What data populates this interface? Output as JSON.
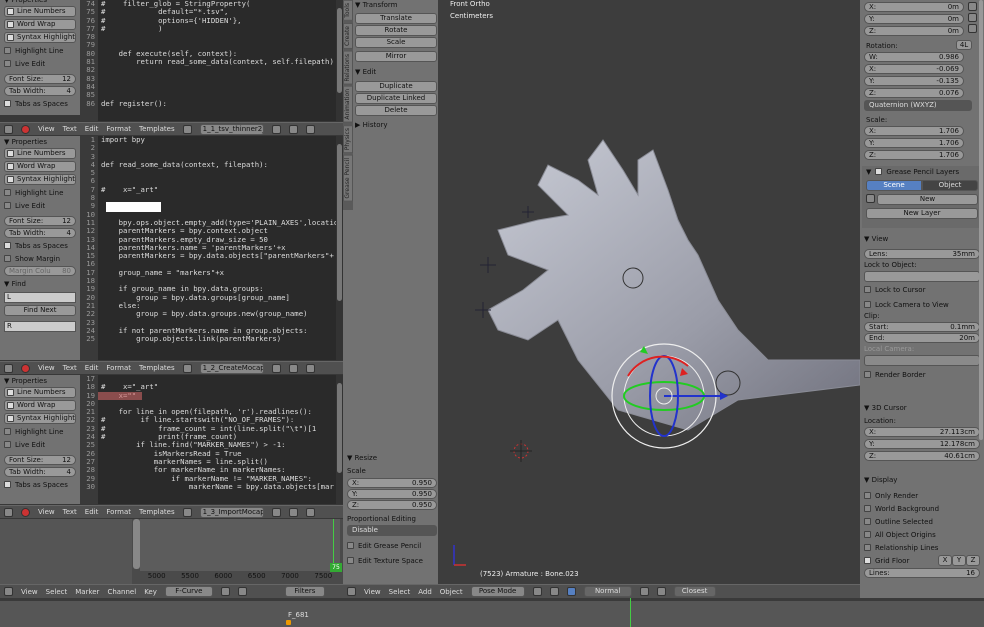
{
  "props_panel": {
    "title": "Properties",
    "line_numbers": "Line Numbers",
    "word_wrap": "Word Wrap",
    "syntax": "Syntax Highlight",
    "highlight_line": "Highlight Line",
    "live_edit": "Live Edit",
    "font_size_label": "Font Size:",
    "font_size": "12",
    "tab_width_label": "Tab Width:",
    "tab_width": "4",
    "tabs_spaces": "Tabs as Spaces",
    "show_margin": "Show Margin",
    "margin_col_label": "Margin Colu",
    "margin_col": "80",
    "find": "Find",
    "find_field": "L",
    "find_next": "Find Next",
    "replace_field": "R"
  },
  "editor_menu": {
    "view": "View",
    "text": "Text",
    "edit": "Edit",
    "format": "Format",
    "templates": "Templates"
  },
  "editors": [
    {
      "file": "1_1_tsv_thinner2_b...",
      "start": 74,
      "lines": [
        "#    filter_glob = StringProperty(",
        "#            default=\"*.tsv\",",
        "#            options={'HIDDEN'},",
        "#            )",
        "",
        "",
        "    def execute(self, context):",
        "        return read_some_data(context, self.filepath)",
        "",
        "",
        "",
        "",
        "def register():"
      ]
    },
    {
      "file": "1_2_CreateMocapM...",
      "start": 1,
      "lines": [
        "import bpy",
        "",
        "",
        "def read_some_data(context, filepath):",
        "",
        "",
        "#    x=\"_art\"",
        "",
        "",
        "",
        "    bpy.ops.object.empty_add(type='PLAIN_AXES',locatio",
        "    parentMarkers = bpy.context.object",
        "    parentMarkers.empty_draw_size = 50",
        "    parentMarkers.name = 'parentMarkers'+x",
        "    parentMarkers = bpy.data.objects[\"parentMarkers\"+",
        "",
        "    group_name = \"markers\"+x",
        "",
        "    if group_name in bpy.data.groups:",
        "        group = bpy.data.groups[group_name]",
        "    else:",
        "        group = bpy.data.groups.new(group_name)",
        "",
        "    if not parentMarkers.name in group.objects:",
        "        group.objects.link(parentMarkers)"
      ]
    },
    {
      "file": "1_3_ImportMocapD...",
      "start": 17,
      "lines": [
        "",
        "#    x=\"_art\"",
        "    x=\"\"",
        "",
        "    for line in open(filepath, 'r').readlines():",
        "#        if line.startswith(\"NO_OF_FRAMES\"):",
        "#            frame_count = int(line.split(\"\\t\")[1",
        "#            print(frame_count)",
        "        if line.find(\"MARKER_NAMES\") > -1:",
        "            isMarkersRead = True",
        "            markerNames = line.split()",
        "            for markerName in markerNames:",
        "                if markerName != \"MARKER_NAMES\":",
        "                    markerName = bpy.data.objects[mar"
      ]
    }
  ],
  "graph": {
    "ticks": [
      "5000",
      "5500",
      "6000",
      "6500",
      "7000",
      "7500"
    ],
    "frame_badge": "75",
    "menu": [
      "View",
      "Select",
      "Marker",
      "Channel",
      "Key"
    ],
    "mode": "F-Curve",
    "filters": "Filters"
  },
  "toolshelf": {
    "tabs": [
      "Tools",
      "Create",
      "Relations",
      "Animation",
      "Physics",
      "Grease Pencil"
    ],
    "transform": "Transform",
    "translate": "Translate",
    "rotate": "Rotate",
    "scale": "Scale",
    "mirror": "Mirror",
    "edit": "Edit",
    "duplicate": "Duplicate",
    "duplicate_linked": "Duplicate Linked",
    "delete": "Delete",
    "history": "History"
  },
  "resize": {
    "title": "Resize",
    "scale_label": "Scale",
    "x": "0.950",
    "y": "0.950",
    "z": "0.950",
    "prop_edit": "Proportional Editing",
    "disable": "Disable",
    "edit_grease": "Edit Grease Pencil",
    "edit_texture": "Edit Texture Space"
  },
  "viewport": {
    "view_name": "Front Ortho",
    "units": "Centimeters",
    "status": "(7523) Armature : Bone.023",
    "menu": [
      "View",
      "Select",
      "Add",
      "Object"
    ],
    "mode": "Pose Mode",
    "pivot": "Normal",
    "snap": "Closest"
  },
  "npanel": {
    "loc": [
      {
        "axis": "X:",
        "val": "0m"
      },
      {
        "axis": "Y:",
        "val": "0m"
      },
      {
        "axis": "Z:",
        "val": "0m"
      }
    ],
    "rotation": "Rotation:",
    "rot_mode_badge": "4L",
    "rot": [
      {
        "axis": "W:",
        "val": "0.986"
      },
      {
        "axis": "X:",
        "val": "-0.069"
      },
      {
        "axis": "Y:",
        "val": "-0.135"
      },
      {
        "axis": "Z:",
        "val": "0.076"
      }
    ],
    "quat": "Quaternion (WXYZ)",
    "scale_label": "Scale:",
    "scale": [
      {
        "axis": "X:",
        "val": "1.706"
      },
      {
        "axis": "Y:",
        "val": "1.706"
      },
      {
        "axis": "Z:",
        "val": "1.706"
      }
    ],
    "gp_layers": "Grease Pencil Layers",
    "scene": "Scene",
    "object": "Object",
    "new": "New",
    "new_layer": "New Layer",
    "view": "View",
    "lens_label": "Lens:",
    "lens": "35mm",
    "lock_obj": "Lock to Object:",
    "lock_cursor": "Lock to Cursor",
    "lock_camera": "Lock Camera to View",
    "clip": "Clip:",
    "clip_start_label": "Start:",
    "clip_start": "0.1mm",
    "clip_end_label": "End:",
    "clip_end": "20m",
    "local_camera": "Local Camera:",
    "render_border": "Render Border",
    "cursor": "3D Cursor",
    "location": "Location:",
    "cur": [
      {
        "axis": "X:",
        "val": "27.113cm"
      },
      {
        "axis": "Y:",
        "val": "12.178cm"
      },
      {
        "axis": "Z:",
        "val": "40.61cm"
      }
    ],
    "display": "Display",
    "only_render": "Only Render",
    "world_bg": "World Background",
    "outline_sel": "Outline Selected",
    "all_origins": "All Object Origins",
    "rel_lines": "Relationship Lines",
    "grid_floor": "Grid Floor",
    "gx": "X",
    "gy": "Y",
    "gz": "Z",
    "lines_label": "Lines:",
    "lines": "16"
  },
  "timeline": {
    "frame": "F_681"
  }
}
